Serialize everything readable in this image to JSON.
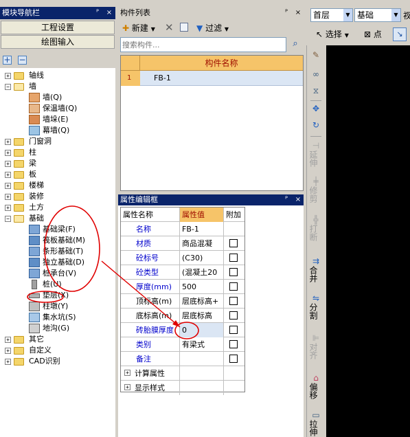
{
  "nav_panel": {
    "title": "模块导航栏",
    "pin": "ᴾ",
    "close": "×",
    "buttons": [
      "工程设置",
      "绘图输入"
    ],
    "tree": [
      {
        "label": "轴线",
        "expand": "+",
        "level": 0
      },
      {
        "label": "墙",
        "expand": "−",
        "level": 0
      },
      {
        "label": "墙(Q)",
        "level": 1
      },
      {
        "label": "保温墙(Q)",
        "level": 1
      },
      {
        "label": "墙垛(E)",
        "level": 1
      },
      {
        "label": "幕墙(Q)",
        "level": 1
      },
      {
        "label": "门窗洞",
        "expand": "+",
        "level": 0
      },
      {
        "label": "柱",
        "expand": "+",
        "level": 0
      },
      {
        "label": "梁",
        "expand": "+",
        "level": 0
      },
      {
        "label": "板",
        "expand": "+",
        "level": 0
      },
      {
        "label": "楼梯",
        "expand": "+",
        "level": 0
      },
      {
        "label": "装修",
        "expand": "+",
        "level": 0
      },
      {
        "label": "土方",
        "expand": "+",
        "level": 0
      },
      {
        "label": "基础",
        "expand": "−",
        "level": 0
      },
      {
        "label": "基础梁(F)",
        "level": 1
      },
      {
        "label": "筏板基础(M)",
        "level": 1
      },
      {
        "label": "条形基础(T)",
        "level": 1
      },
      {
        "label": "独立基础(D)",
        "level": 1
      },
      {
        "label": "桩承台(V)",
        "level": 1
      },
      {
        "label": "桩(U)",
        "level": 1
      },
      {
        "label": "垫层(X)",
        "level": 1
      },
      {
        "label": "柱墩(Y)",
        "level": 1
      },
      {
        "label": "集水坑(S)",
        "level": 1
      },
      {
        "label": "地沟(G)",
        "level": 1
      },
      {
        "label": "其它",
        "expand": "+",
        "level": 0
      },
      {
        "label": "自定义",
        "expand": "+",
        "level": 0
      },
      {
        "label": "CAD识别",
        "expand": "+",
        "level": 0
      }
    ]
  },
  "component_list": {
    "title": "构件列表",
    "toolbar": {
      "new": "新建",
      "filter": "过滤"
    },
    "search_placeholder": "搜索构件...",
    "column": "构件名称",
    "rows": [
      {
        "index": "1",
        "name": "FB-1"
      }
    ]
  },
  "property_editor": {
    "title": "属性编辑框",
    "headers": [
      "属性名称",
      "属性值",
      "附加"
    ],
    "rows": [
      {
        "name": "名称",
        "value": "FB-1",
        "check": false,
        "name_color": "#0000cc",
        "value_bg": "#ffffff"
      },
      {
        "name": "材质",
        "value": "商品混凝",
        "check": true,
        "name_color": "#0000cc",
        "value_bg": "#ffffff"
      },
      {
        "name": "砼标号",
        "value": "(C30)",
        "check": true,
        "name_color": "#0000cc",
        "value_bg": "#ffffff"
      },
      {
        "name": "砼类型",
        "value": "(混凝土20",
        "check": true,
        "name_color": "#0000cc",
        "value_bg": "#ffffff"
      },
      {
        "name": "厚度(mm)",
        "value": "500",
        "check": true,
        "name_color": "#0000cc",
        "value_bg": "#ffffff"
      },
      {
        "name": "顶标高(m)",
        "value": "层底标高+",
        "check": true,
        "name_color": "#000000",
        "value_bg": "#ffffff"
      },
      {
        "name": "底标高(m)",
        "value": "层底标高",
        "check": true,
        "name_color": "#000000",
        "value_bg": "#ffffff"
      },
      {
        "name": "砖胎膜厚度",
        "value": "0",
        "check": true,
        "name_color": "#0000cc",
        "value_bg": "#dbe6f4"
      },
      {
        "name": "类别",
        "value": "有梁式",
        "check": true,
        "name_color": "#0000cc",
        "value_bg": "#ffffff"
      },
      {
        "name": "备注",
        "value": "",
        "check": true,
        "name_color": "#0000cc",
        "value_bg": "#ffffff"
      },
      {
        "name": "计算属性",
        "value": "",
        "check": null,
        "expand": "+",
        "name_color": "#000000",
        "value_bg": "#ffffff"
      },
      {
        "name": "显示样式",
        "value": "",
        "check": null,
        "expand": "+",
        "name_color": "#000000",
        "value_bg": "#ffffff"
      }
    ]
  },
  "right_toolbar": {
    "floor": "首层",
    "category": "基础",
    "extra": "衩",
    "select": "选择",
    "point": "点",
    "tools": [
      "延伸",
      "修剪",
      "打断",
      "合并",
      "分割",
      "对齐",
      "偏移",
      "拉伸"
    ]
  },
  "annotation_color": "#e00000"
}
